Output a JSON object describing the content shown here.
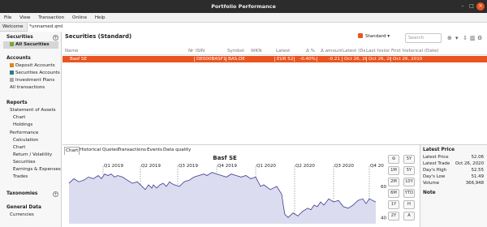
{
  "window": {
    "title": "Portfolio Performance",
    "min_glyph": "–",
    "max_glyph": "□",
    "close_glyph": "×"
  },
  "menu": [
    "File",
    "View",
    "Transaction",
    "Online",
    "Help"
  ],
  "sidebar": {
    "tabs": [
      "Welcome",
      "*unnamed.xml"
    ],
    "sections": {
      "securities": {
        "title": "Securities",
        "items": [
          "All Securities"
        ]
      },
      "accounts": {
        "title": "Accounts",
        "items": [
          "Deposit Accounts",
          "Securities Accounts",
          "Investment Plans",
          "All transactions"
        ]
      },
      "reports": {
        "title": "Reports",
        "statement": "Statement of Assets",
        "statement_items": [
          "Chart",
          "Holdings"
        ],
        "performance": "Performance",
        "performance_items": [
          "Calculation",
          "Chart",
          "Return / Volatility",
          "Securities",
          "Earnings & Expenses",
          "Trades"
        ]
      },
      "taxonomies": {
        "title": "Taxonomies"
      },
      "general_data": {
        "title": "General Data",
        "items": [
          "Currencies"
        ]
      }
    },
    "colors": {
      "deposit": "#d9891b",
      "securities": "#2a7d8c",
      "plans": "#aaaaaa",
      "all_securities": "#7aa53a"
    }
  },
  "main": {
    "title": "Securities (Standard)",
    "view_dropdown": "Standard",
    "search_placeholder": "Search",
    "columns": [
      "Name",
      "Nr",
      "ISIN",
      "Symbol",
      "WKN",
      "Latest",
      "Δ %",
      "Δ amount",
      "Latest (Da",
      "Last histor",
      "First historical (Date)"
    ],
    "rows": [
      {
        "name": "Basf SE",
        "nr": "",
        "isin": "DE000BASF11",
        "symbol": "BAS.DE",
        "wkn": "",
        "latest": "EUR 52.0",
        "delta_pct": "-0.40%",
        "delta_amt": "-0.21",
        "latest_date": "Oct 26, 202",
        "last_hist": "Oct 26, 202",
        "first_hist": "Oct 26, 2010"
      }
    ],
    "accent": "#e95420"
  },
  "chart_panel": {
    "tabs": [
      "Chart",
      "Historical Quotes",
      "Transactions",
      "Events",
      "Data quality"
    ],
    "range_buttons": [
      "5Y",
      "1M",
      "5Y",
      "2M",
      "10Y",
      "6M",
      "YTD",
      "1Y",
      "H",
      "2Y",
      "A"
    ]
  },
  "chart_data": {
    "type": "area",
    "title": "Basf SE",
    "quarter_labels": [
      "Q1 2019",
      "Q2 2019",
      "Q3 2019",
      "Q4 2019",
      "Q1 2020",
      "Q2 2020",
      "Q3 2020",
      "Q4 20"
    ],
    "y_ticks": [
      60,
      40
    ],
    "ylim": [
      36,
      73
    ],
    "x": [
      0,
      6,
      12,
      18,
      24,
      30,
      36,
      40,
      44,
      48,
      52,
      56,
      60,
      66,
      72,
      78,
      84,
      90,
      94,
      98,
      102,
      104,
      108,
      112,
      116,
      120,
      124,
      126,
      130,
      136,
      142,
      148,
      154,
      160,
      166,
      170,
      176,
      182,
      188,
      194,
      200,
      206,
      212,
      218,
      224,
      230,
      236,
      240,
      248,
      256,
      262,
      264,
      266,
      270,
      276,
      282,
      288,
      294,
      298,
      302,
      306,
      310,
      314,
      320,
      326,
      332,
      338,
      344,
      350,
      356,
      362,
      366,
      370,
      374,
      378
    ],
    "y": [
      62,
      65,
      63,
      64,
      66,
      65,
      67,
      65,
      68,
      67,
      68,
      66,
      67,
      66,
      64,
      62,
      63,
      60,
      58,
      61,
      59,
      61,
      59,
      61,
      62,
      60,
      63,
      62,
      61,
      60,
      63,
      64,
      66,
      67,
      68,
      67,
      69,
      68,
      67,
      66,
      68,
      67,
      66,
      67,
      65,
      66,
      60,
      61,
      58,
      60,
      55,
      48,
      42,
      40,
      43,
      41,
      44,
      46,
      45,
      48,
      47,
      50,
      48,
      52,
      50,
      51,
      47,
      46,
      48,
      51,
      52,
      49,
      52,
      51,
      50
    ],
    "xlim": [
      0,
      380
    ],
    "quarter_x": [
      42,
      88,
      134,
      182,
      230,
      278,
      326,
      370
    ]
  },
  "info_panel": {
    "title": "Latest Price",
    "rows": [
      {
        "label": "Latest Price",
        "value": "52.06"
      },
      {
        "label": "Latest Trade",
        "value": "Oct 26, 2020"
      },
      {
        "label": "Day's High",
        "value": "52.55"
      },
      {
        "label": "Day's Low",
        "value": "51.49"
      },
      {
        "label": "Volume",
        "value": "366,948"
      }
    ],
    "note_title": "Note"
  }
}
